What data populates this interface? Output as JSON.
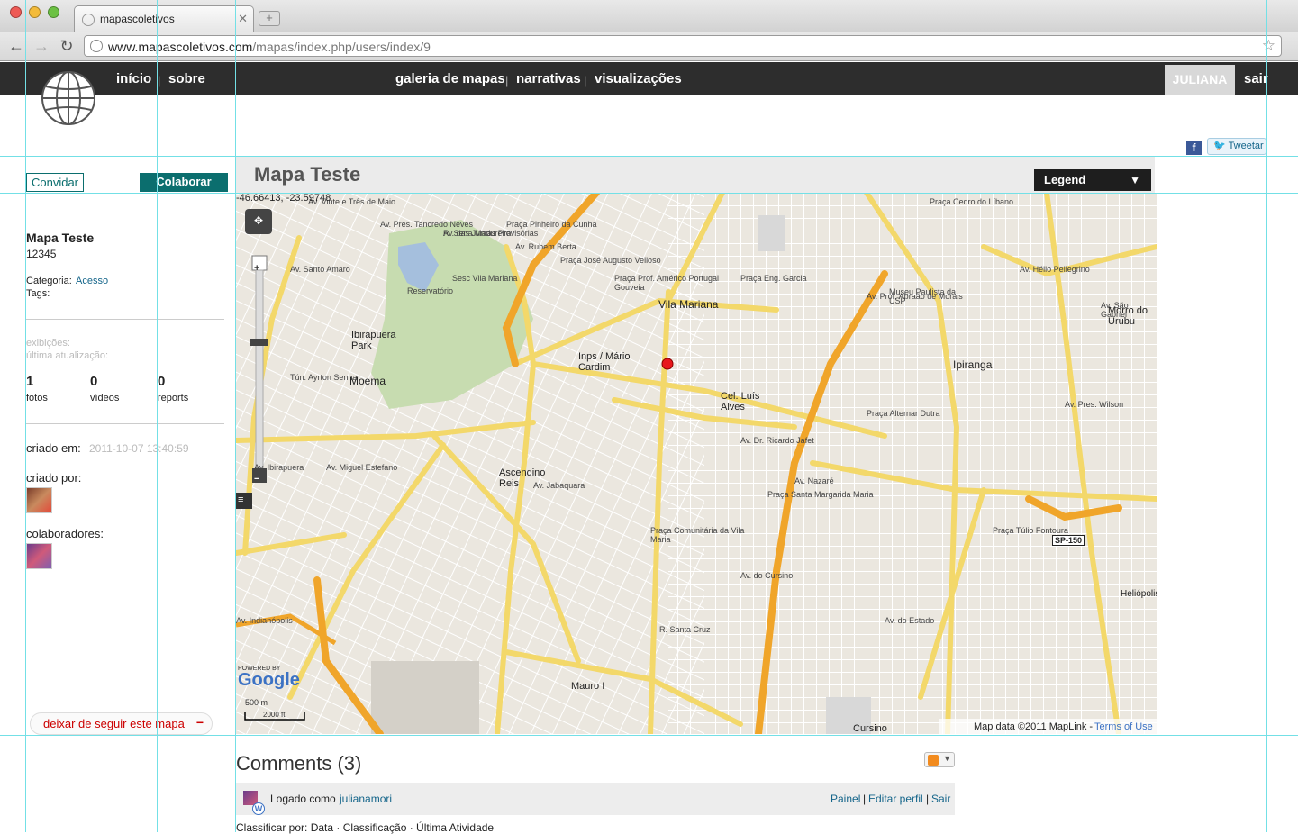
{
  "browser": {
    "tab_title": "mapascoletivos",
    "tab_close": "✕",
    "url_host": "www.mapascoletivos.com",
    "url_path": "/mapas/index.php/users/index/9"
  },
  "site_nav": {
    "inicio": "início",
    "sobre": "sobre",
    "galeria": "galeria de mapas",
    "narrativas": "narrativas",
    "visualizacoes": "visualizações",
    "separator": "|",
    "user": "JULIANA",
    "sair": "sair"
  },
  "share": {
    "tweet": "Tweetar",
    "facebook_icon": "facebook-icon"
  },
  "sidebar": {
    "convidar": "Convidar",
    "colaborar": "Colaborar",
    "map_name": "Mapa Teste",
    "map_id": "12345",
    "categoria_label": "Categoria:",
    "categoria_value": "Acesso",
    "tags_label": "Tags:",
    "exibicoes": "exibições:",
    "ultima_atualizacao": "última atualização:",
    "stats": [
      {
        "value": "1",
        "label": "fotos"
      },
      {
        "value": "0",
        "label": "vídeos"
      },
      {
        "value": "0",
        "label": "reports"
      }
    ],
    "criado_em_label": "criado em:",
    "criado_em_value": "2011-10-07 13:40:59",
    "criado_por_label": "criado por:",
    "colaboradores_label": "colaboradores:",
    "unfollow": "deixar de seguir este mapa",
    "unfollow_icon": "−"
  },
  "map": {
    "title": "Mapa Teste",
    "legend": "Legend",
    "legend_arrow": "▼",
    "coords": "-46.66413, -23.59748",
    "attribution": "Map data ©2011 MapLink -",
    "terms": "Terms of Use",
    "scale_m": "500 m",
    "scale_ft": "2000 ft",
    "powered": "POWERED BY",
    "google": "Google",
    "labels": [
      "Vila Mariana",
      "Ipiranga",
      "Moema",
      "Ibirapuera Park",
      "Cel. Luís Alves",
      "Ascendino Reis",
      "Inps / Mário Cardim",
      "Mauro I",
      "Cursino",
      "Morro do Urubu",
      "Reservatório",
      "Tún. Ayrton Senna",
      "Av. Vinte e Três de Maio",
      "Av. Rubem Berta",
      "R. Sena Madureira",
      "Av. Dr. Ricardo Jafet",
      "Av. Prof. Abraão de Morais",
      "Av. Nazaré",
      "R. Santa Cruz",
      "Av. do Cursino",
      "Av. Jabaquara",
      "Av. Miguel Estefano",
      "Av. Ibirapuera",
      "Av. Indianópolis",
      "Av. Santo Amaro",
      "Av. Hélio Pellegrino",
      "Av. São Gabriel",
      "Av. Pres. Wilson",
      "Av. do Estado",
      "Av. Pres. Tancredo Neves",
      "Av. das Juntas Provisórias",
      "SP-150",
      "Praça Cedro do Líbano",
      "Praça Túlio Fontoura",
      "Museu Paulista da USP",
      "Praça Eng. Garcia",
      "Heliópolis",
      "Praça Alternar Dutra",
      "Praça Santa Margarida Maria",
      "Praça Comunitária da Vila Maria",
      "Praça Pinheiro da Cunha",
      "Praça José Augusto Velloso",
      "Praça Prof. Américo Portugal Gouveia",
      "Sesc Vila Mariana"
    ]
  },
  "comments": {
    "heading": "Comments (3)",
    "logged_as": "Logado como",
    "username": "julianamori",
    "painel": "Painel",
    "editar_perfil": "Editar perfil",
    "sair": "Sair",
    "sep": "|",
    "classify": "Classificar por: Data · Classificação · Última Atividade"
  }
}
